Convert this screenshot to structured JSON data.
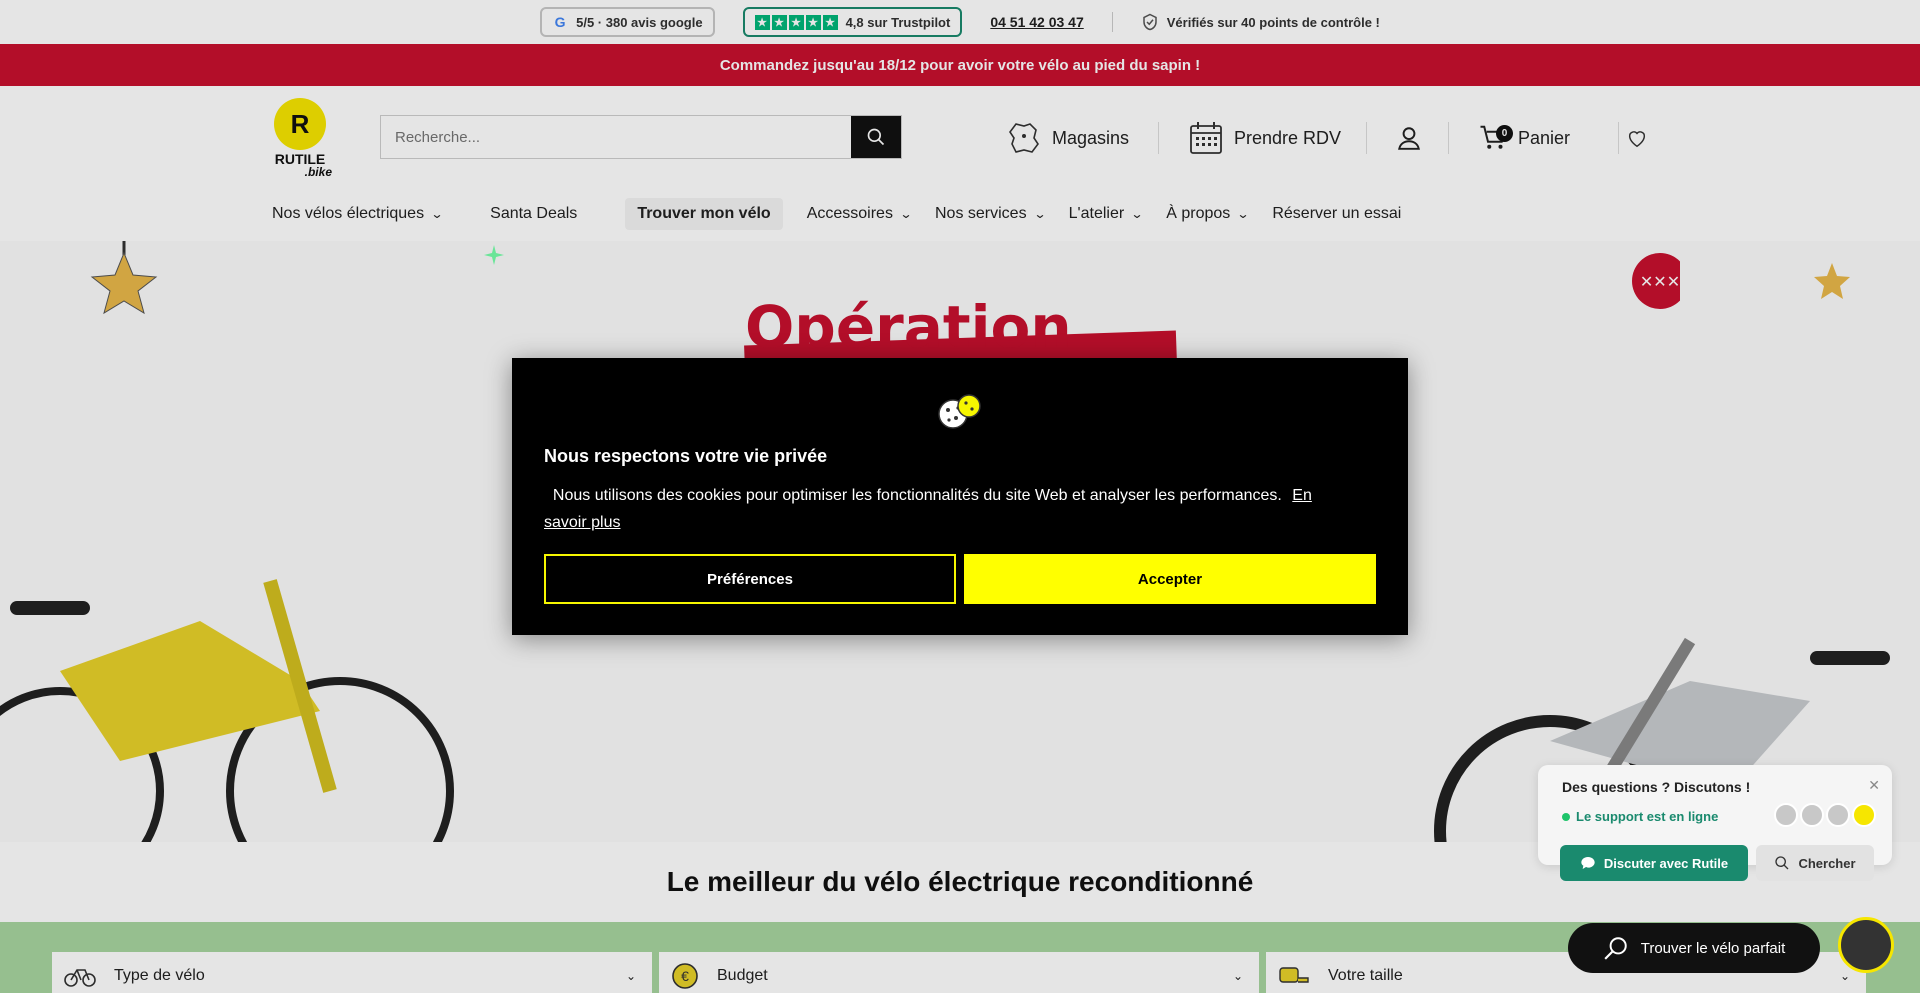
{
  "topbar": {
    "google_rating": "5/5 · 380 avis google",
    "trustpilot_rating": "4,8 sur Trustpilot",
    "phone": "04 51 42 03 47",
    "verified": "Vérifiés sur 40 points de contrôle !"
  },
  "promo": {
    "text": "Commandez jusqu'au 18/12 pour avoir votre vélo au pied du sapin !"
  },
  "header": {
    "logo_text": "RUTILE",
    "logo_sub": ".bike",
    "search_placeholder": "Recherche...",
    "stores": "Magasins",
    "appointment": "Prendre RDV",
    "cart_label": "Panier",
    "cart_count": "0"
  },
  "nav": {
    "items": [
      "Nos vélos électriques",
      "Santa Deals",
      "Trouver mon vélo",
      "Accessoires",
      "Nos services",
      "L'atelier",
      "À propos",
      "Réserver un essai"
    ]
  },
  "hero": {
    "title": "Opération"
  },
  "section": {
    "title": "Le meilleur du vélo électrique reconditionné"
  },
  "filters": {
    "type": "Type de vélo",
    "budget": "Budget",
    "size": "Votre taille"
  },
  "cookie_modal": {
    "title": "Nous respectons votre vie privée",
    "body": "Nous utilisons des cookies pour optimiser les fonctionnalités du site Web et analyser les performances.",
    "learn_more": "En savoir plus",
    "preferences": "Préférences",
    "accept": "Accepter"
  },
  "chat": {
    "title": "Des questions ? Discutons !",
    "status": "Le support est en ligne",
    "chat_button": "Discuter avec Rutile",
    "search_button": "Chercher"
  },
  "finder": {
    "label": "Trouver le vélo parfait"
  },
  "colors": {
    "brand_yellow": "#f6e600",
    "promo_red": "#c8102e",
    "trustpilot_green": "#00b67a",
    "chat_green": "#1a8a6e"
  }
}
